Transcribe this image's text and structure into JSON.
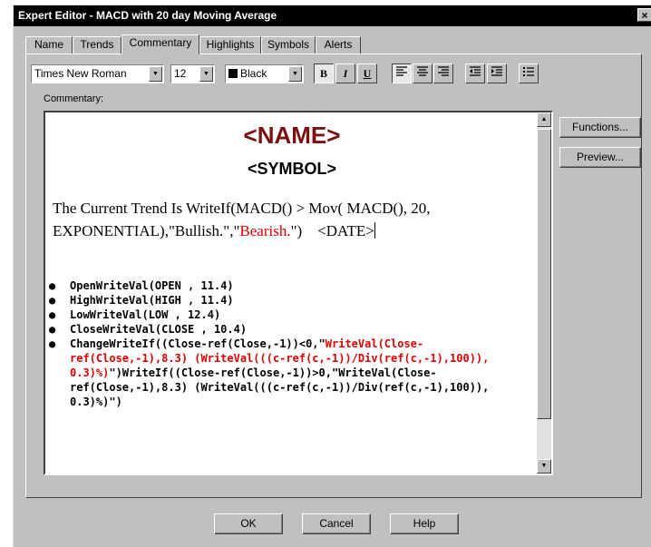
{
  "window": {
    "title": "Expert Editor - MACD with 20 day Moving Average",
    "close_glyph": "×"
  },
  "tabs": [
    {
      "label": "Name"
    },
    {
      "label": "Trends"
    },
    {
      "label": "Commentary"
    },
    {
      "label": "Highlights"
    },
    {
      "label": "Symbols"
    },
    {
      "label": "Alerts"
    }
  ],
  "active_tab": "Commentary",
  "toolbar": {
    "font_family": "Times New Roman",
    "font_size": "12",
    "color_label": "Black",
    "bold_label": "B",
    "italic_label": "I",
    "underline_label": "U",
    "icons": [
      "align-left-icon",
      "align-center-icon",
      "align-right-icon",
      "decrease-indent-icon",
      "increase-indent-icon",
      "bullet-list-icon"
    ]
  },
  "commentary_label": "Commentary:",
  "side_buttons": {
    "functions": "Functions...",
    "preview": "Preview..."
  },
  "editor": {
    "heading_name": "<NAME>",
    "heading_symbol": "<SYMBOL>",
    "trend_prefix": "The Current Trend Is WriteIf(MACD() > Mov( MACD(), 20, EXPONENTIAL),\"Bullish.\",\"",
    "trend_bearish": "Bearish.",
    "trend_suffix": "\")",
    "trend_date": "<DATE>",
    "bullets": [
      "OpenWriteVal(OPEN , 11.4)",
      "HighWriteVal(HIGH , 11.4)",
      "LowWriteVal(LOW , 12.4)",
      "CloseWriteVal(CLOSE , 10.4)"
    ],
    "change_part1": "ChangeWriteIf((Close-ref(Close,-1))<0,\"",
    "change_red": "WriteVal(Close-ref(Close,-1),8.3) (WriteVal(((c-ref(c,-1))/Div(ref(c,-1),100)), 0.3)%)",
    "change_part2": "\")WriteIf((Close-ref(Close,-1))>0,\"WriteVal(Close-ref(Close,-1),8.3) (WriteVal(((c-ref(c,-1))/Div(ref(c,-1),100)), 0.3)%)\")"
  },
  "buttons": {
    "ok": "OK",
    "cancel": "Cancel",
    "help": "Help"
  },
  "colors": {
    "title_bar": "#000000",
    "name_heading": "#7a1010",
    "bearish_text": "#e00000",
    "dialog_bg": "#c0c0c0"
  }
}
